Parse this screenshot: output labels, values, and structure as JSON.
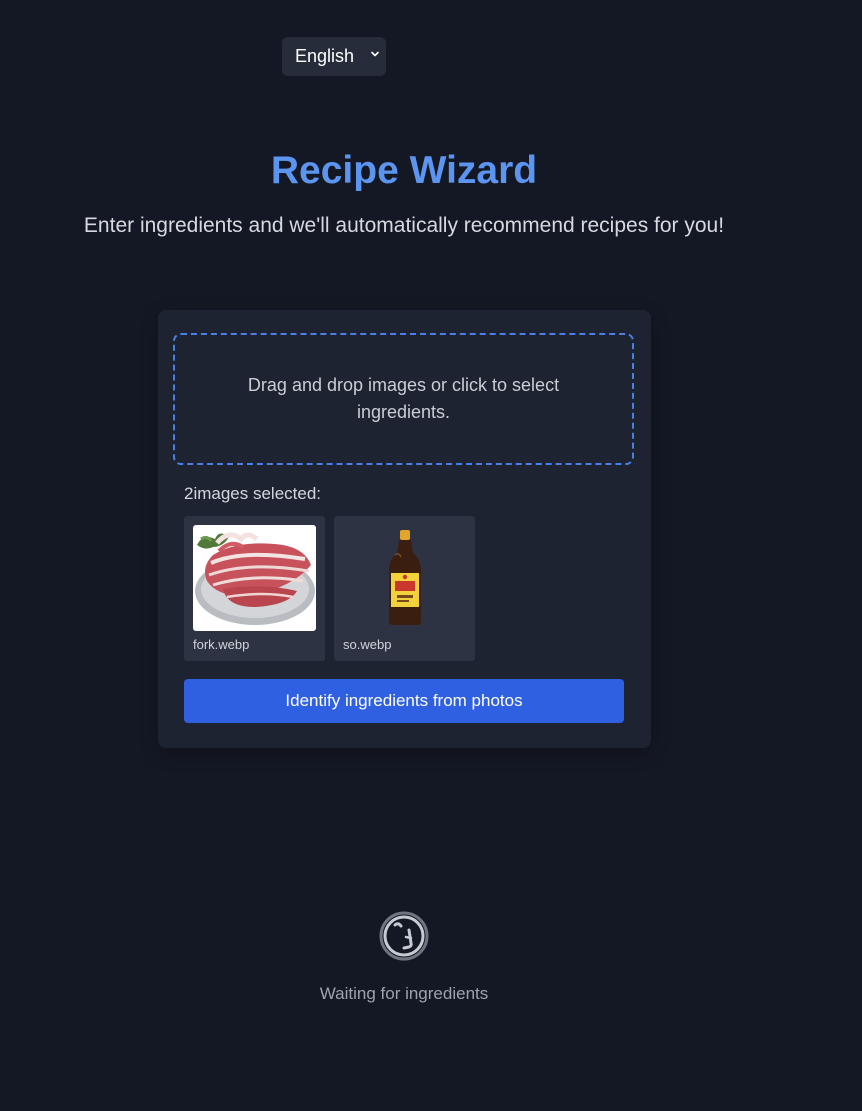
{
  "language": {
    "selected": "English"
  },
  "header": {
    "title": "Recipe Wizard",
    "subtitle": "Enter ingredients and we'll automatically recommend recipes for you!"
  },
  "upload": {
    "dropzone_text": "Drag and drop images or click to select ingredients.",
    "selected_count": "2images selected:",
    "images": [
      {
        "name": "fork.webp"
      },
      {
        "name": "so.webp"
      }
    ],
    "identify_button": "Identify ingredients from photos"
  },
  "status": {
    "text": "Waiting for ingredients"
  },
  "colors": {
    "background": "#141824",
    "card": "#1e2332",
    "accent": "#5c95f0",
    "button": "#3060e2"
  }
}
